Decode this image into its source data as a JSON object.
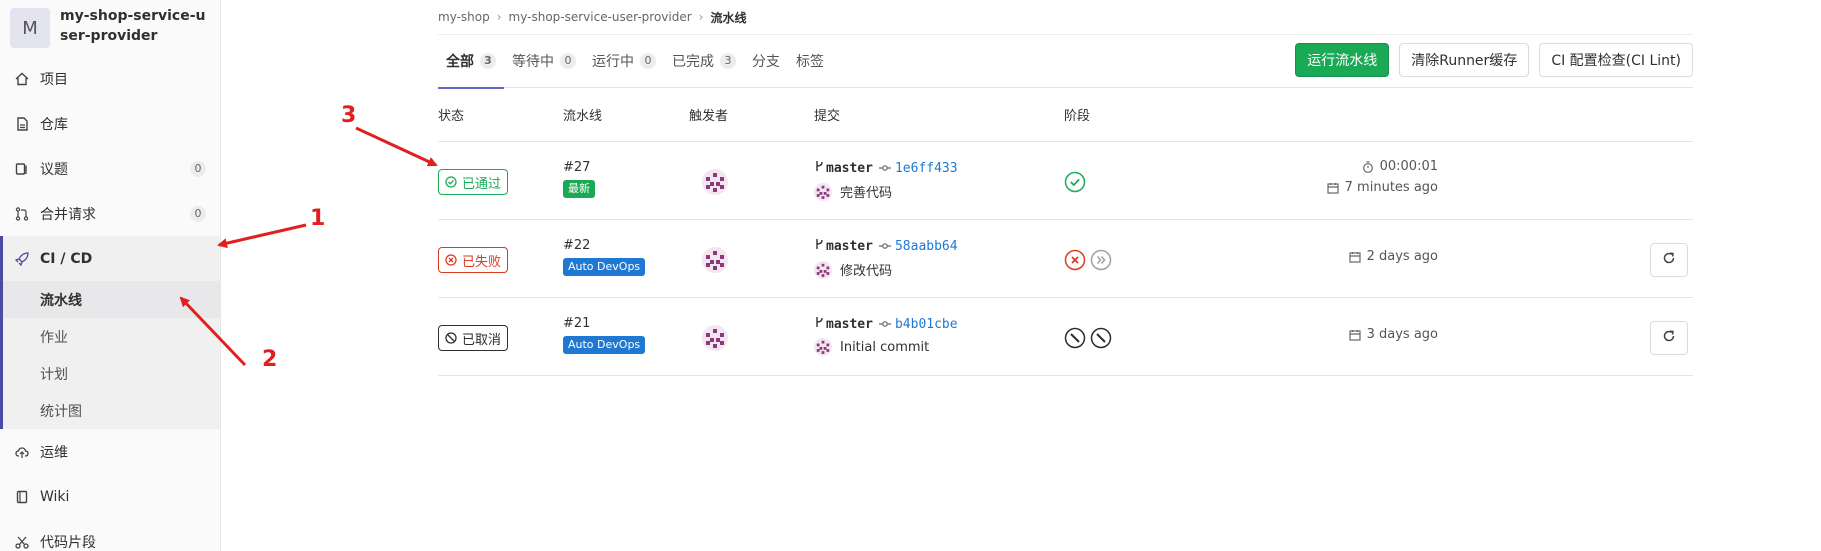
{
  "project": {
    "avatar_letter": "M",
    "name": "my-shop-service-user-provider"
  },
  "sidebar": {
    "items": [
      {
        "label": "项目",
        "icon": "home-icon"
      },
      {
        "label": "仓库",
        "icon": "doc-icon"
      },
      {
        "label": "议题",
        "icon": "issues-icon",
        "count": "0"
      },
      {
        "label": "合并请求",
        "icon": "merge-icon",
        "count": "0"
      },
      {
        "label": "CI / CD",
        "icon": "rocket-icon"
      },
      {
        "label": "运维",
        "icon": "cloud-icon"
      },
      {
        "label": "Wiki",
        "icon": "book-icon"
      },
      {
        "label": "代码片段",
        "icon": "snippet-icon"
      }
    ],
    "cicd_sub": [
      "流水线",
      "作业",
      "计划",
      "统计图"
    ]
  },
  "breadcrumb": {
    "parts": [
      "my-shop",
      "my-shop-service-user-provider",
      "流水线"
    ]
  },
  "tabs": [
    {
      "label": "全部",
      "count": "3"
    },
    {
      "label": "等待中",
      "count": "0"
    },
    {
      "label": "运行中",
      "count": "0"
    },
    {
      "label": "已完成",
      "count": "3"
    },
    {
      "label": "分支",
      "count": ""
    },
    {
      "label": "标签",
      "count": ""
    }
  ],
  "actions": {
    "run": "运行流水线",
    "clear": "清除Runner缓存",
    "lint": "CI 配置检查(CI Lint)"
  },
  "columns": {
    "status": "状态",
    "pipeline": "流水线",
    "trigger": "触发者",
    "commit": "提交",
    "stages": "阶段"
  },
  "rows": [
    {
      "status": "已通过",
      "id": "#27",
      "tag": "最新",
      "branch": "master",
      "sha": "1e6ff433",
      "message": "完善代码",
      "duration": "00:00:01",
      "time": "7 minutes ago"
    },
    {
      "status": "已失败",
      "id": "#22",
      "tag": "Auto DevOps",
      "branch": "master",
      "sha": "58aabb64",
      "message": "修改代码",
      "duration": "",
      "time": "2 days ago"
    },
    {
      "status": "已取消",
      "id": "#21",
      "tag": "Auto DevOps",
      "branch": "master",
      "sha": "b4b01cbe",
      "message": "Initial commit",
      "duration": "",
      "time": "3 days ago"
    }
  ],
  "annotations": [
    "1",
    "2",
    "3"
  ],
  "colors": {
    "success": "#1aaa55",
    "failed": "#db3b21",
    "canceled": "#2e2e2e",
    "accent": "#4b4ba3",
    "link": "#1f78d1",
    "arrow": "#e02020"
  }
}
